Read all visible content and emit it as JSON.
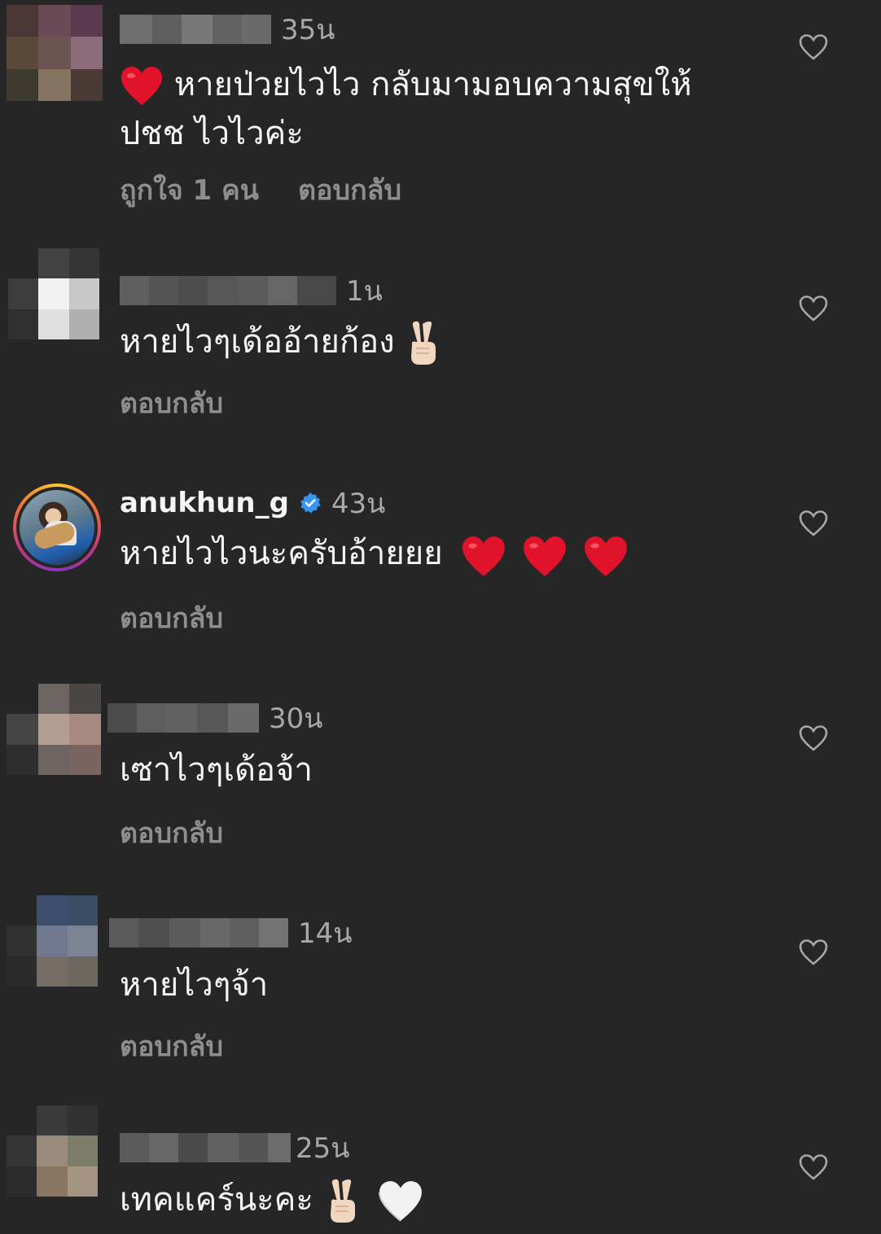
{
  "comments": [
    {
      "time": "35น",
      "text": "หายป่วยไวไว กลับมามอบความสุขให้ ปชช ไวไวค่ะ",
      "lead_emoji": "red-heart",
      "likes_label": "ถูกใจ 1 คน",
      "reply_label": "ตอบกลับ"
    },
    {
      "time": "1น",
      "text": "หายไวๆเด้ออ้ายก้อง",
      "trail_emoji": "victory-hand",
      "reply_label": "ตอบกลับ"
    },
    {
      "username": "anukhun_g",
      "verified": true,
      "time": "43น",
      "text": "หายไวไวนะครับอ้ายยย",
      "trail_emoji": "three-red-hearts",
      "reply_label": "ตอบกลับ"
    },
    {
      "time": "30น",
      "text": "เซาไวๆเด้อจ้า",
      "reply_label": "ตอบกลับ"
    },
    {
      "time": "14น",
      "text": "หายไวๆจ้า",
      "reply_label": "ตอบกลับ"
    },
    {
      "time": "25น",
      "text": "เทคแคร์นะคะ",
      "trail_emoji": "victory-hand-white-heart",
      "reply_label": ""
    }
  ],
  "colors": {
    "background": "#262626",
    "primary_text": "#f5f5f5",
    "secondary_text": "#a8a8a8",
    "meta_text": "#8e8e8e",
    "verified_blue": "#3797f0",
    "heart_red": "#e0132b"
  }
}
